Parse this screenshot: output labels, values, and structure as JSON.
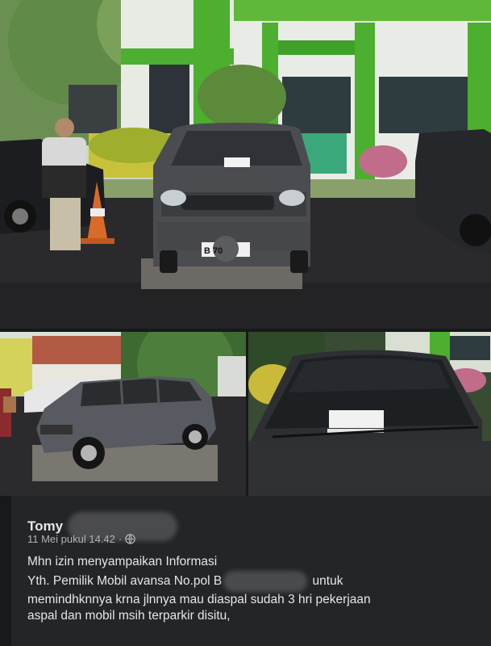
{
  "photos": {
    "top_plate_text": "B   70",
    "top_notice_paper": "",
    "right_notice_paper": ""
  },
  "post": {
    "author": "Tomy",
    "date": "11 Mei pukul 14.42",
    "separator": "·",
    "privacy_icon": "globe-icon",
    "lines": [
      "Mhn izin menyampaikan Informasi",
      "Yth. Pemilik Mobil avansa No.pol",
      "untuk",
      "memindhknnya krna jlnnya mau diaspal sudah 3 hri pekerjaan",
      "aspal dan mobil msih terparkir disitu,"
    ],
    "plate_prefix": "B"
  },
  "colors": {
    "post_bg": "#242526",
    "text": "#e4e6eb",
    "meta": "#b0b3b8",
    "building_green": "#4caf2f"
  }
}
